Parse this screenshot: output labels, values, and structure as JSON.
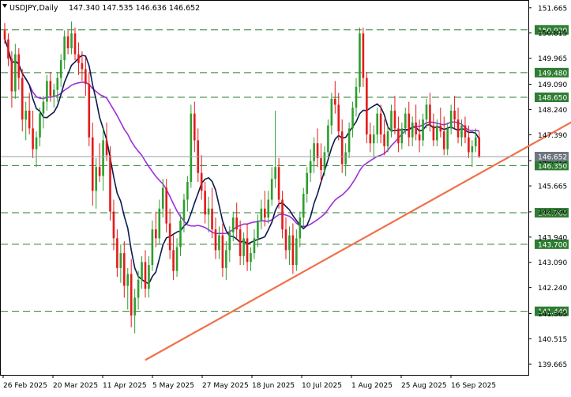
{
  "header": {
    "symbol": "USDJPY,Daily",
    "ohlc": "147.340 147.535 146.636 146.652"
  },
  "chart_data": {
    "type": "candlestick",
    "symbol": "USDJPY",
    "timeframe": "Daily",
    "ylim": [
      139.3,
      151.9
    ],
    "y_ticks": [
      "151.665",
      "150.815",
      "149.965",
      "149.090",
      "148.240",
      "147.390",
      "146.515",
      "145.665",
      "144.790",
      "143.940",
      "143.090",
      "142.240",
      "141.365",
      "140.515",
      "139.665"
    ],
    "x_labels": [
      "26 Feb 2025",
      "20 Mar 2025",
      "11 Apr 2025",
      "5 May 2025",
      "27 May 2025",
      "18 Jun 2025",
      "10 Jul 2025",
      "1 Aug 2025",
      "25 Aug 2025",
      "16 Sep 2025"
    ],
    "levels": [
      150.92,
      149.48,
      148.65,
      146.35,
      144.76,
      143.7,
      141.44
    ],
    "level_labels": [
      "150.920",
      "149.480",
      "148.650",
      "146.350",
      "144.760",
      "143.700",
      "141.440"
    ],
    "current_price": 146.652,
    "current_label": "146.652",
    "trendline": {
      "from": [
        40,
        139.8
      ],
      "to": [
        175,
        148.72
      ]
    },
    "candles": [
      [
        150.9,
        151.15,
        150.45,
        150.6
      ],
      [
        150.6,
        150.8,
        149.7,
        149.95
      ],
      [
        149.95,
        150.2,
        148.3,
        148.85
      ],
      [
        148.85,
        150.45,
        148.6,
        150.1
      ],
      [
        150.1,
        150.3,
        148.9,
        149.3
      ],
      [
        149.3,
        149.6,
        147.5,
        147.9
      ],
      [
        147.9,
        148.5,
        147.2,
        148.2
      ],
      [
        148.2,
        148.8,
        147.4,
        147.6
      ],
      [
        147.6,
        148.2,
        146.6,
        146.9
      ],
      [
        146.9,
        147.5,
        146.3,
        147.3
      ],
      [
        147.3,
        148.3,
        147.0,
        148.1
      ],
      [
        148.1,
        148.7,
        147.6,
        148.5
      ],
      [
        148.5,
        149.4,
        148.2,
        149.2
      ],
      [
        149.2,
        149.5,
        148.5,
        148.7
      ],
      [
        148.7,
        149.1,
        148.3,
        148.9
      ],
      [
        148.9,
        149.5,
        148.5,
        149.3
      ],
      [
        149.3,
        150.1,
        149.0,
        149.9
      ],
      [
        149.9,
        150.9,
        149.6,
        150.7
      ],
      [
        150.7,
        150.9,
        150.1,
        150.3
      ],
      [
        150.3,
        151.2,
        150.1,
        150.8
      ],
      [
        150.8,
        151.0,
        149.9,
        150.1
      ],
      [
        150.1,
        150.5,
        149.4,
        149.8
      ],
      [
        149.8,
        150.2,
        149.2,
        149.6
      ],
      [
        149.6,
        150.0,
        148.7,
        149.1
      ],
      [
        149.1,
        149.5,
        147.0,
        147.3
      ],
      [
        147.3,
        147.8,
        145.0,
        145.5
      ],
      [
        145.5,
        146.6,
        144.9,
        146.3
      ],
      [
        146.3,
        147.1,
        145.8,
        146.0
      ],
      [
        146.0,
        147.6,
        145.5,
        147.2
      ],
      [
        147.2,
        147.8,
        146.5,
        146.7
      ],
      [
        146.7,
        147.0,
        144.5,
        144.8
      ],
      [
        144.8,
        145.2,
        143.5,
        143.9
      ],
      [
        143.9,
        144.2,
        142.6,
        142.9
      ],
      [
        142.9,
        143.7,
        142.4,
        143.4
      ],
      [
        143.4,
        143.8,
        141.9,
        142.3
      ],
      [
        142.3,
        142.9,
        141.5,
        142.7
      ],
      [
        142.7,
        143.2,
        140.9,
        141.3
      ],
      [
        141.3,
        142.2,
        140.7,
        141.9
      ],
      [
        141.9,
        142.8,
        141.5,
        142.5
      ],
      [
        142.5,
        143.3,
        142.2,
        143.1
      ],
      [
        143.1,
        143.5,
        141.9,
        142.2
      ],
      [
        142.2,
        143.3,
        141.9,
        143.0
      ],
      [
        143.0,
        144.5,
        142.8,
        144.2
      ],
      [
        144.2,
        144.8,
        143.6,
        143.9
      ],
      [
        143.9,
        145.2,
        143.7,
        144.9
      ],
      [
        144.9,
        145.9,
        144.6,
        145.6
      ],
      [
        145.6,
        145.9,
        144.1,
        144.4
      ],
      [
        144.4,
        144.9,
        143.2,
        143.5
      ],
      [
        143.5,
        144.0,
        142.5,
        142.8
      ],
      [
        142.8,
        143.9,
        142.6,
        143.6
      ],
      [
        143.6,
        144.7,
        143.3,
        144.5
      ],
      [
        144.5,
        145.4,
        144.1,
        145.2
      ],
      [
        145.2,
        146.0,
        144.8,
        145.8
      ],
      [
        145.8,
        148.4,
        145.6,
        148.1
      ],
      [
        148.1,
        148.5,
        146.8,
        147.2
      ],
      [
        147.2,
        147.6,
        145.8,
        146.1
      ],
      [
        146.1,
        146.7,
        145.2,
        145.5
      ],
      [
        145.5,
        145.8,
        144.4,
        144.7
      ],
      [
        144.7,
        145.3,
        144.1,
        144.9
      ],
      [
        144.9,
        145.6,
        143.9,
        144.2
      ],
      [
        144.2,
        144.6,
        143.2,
        143.5
      ],
      [
        143.5,
        144.3,
        143.2,
        144.0
      ],
      [
        144.0,
        144.4,
        142.6,
        142.9
      ],
      [
        142.9,
        143.8,
        142.5,
        143.5
      ],
      [
        143.5,
        144.3,
        143.1,
        144.1
      ],
      [
        144.1,
        144.8,
        143.8,
        144.6
      ],
      [
        144.6,
        145.1,
        143.9,
        144.2
      ],
      [
        144.2,
        144.5,
        143.0,
        143.3
      ],
      [
        143.3,
        144.1,
        143.0,
        143.9
      ],
      [
        143.9,
        144.4,
        142.8,
        143.1
      ],
      [
        143.1,
        143.6,
        142.8,
        143.4
      ],
      [
        143.4,
        144.2,
        143.2,
        143.9
      ],
      [
        143.9,
        144.7,
        143.6,
        144.5
      ],
      [
        144.5,
        145.2,
        144.2,
        144.9
      ],
      [
        144.9,
        145.5,
        144.3,
        144.6
      ],
      [
        144.6,
        145.5,
        144.4,
        145.2
      ],
      [
        145.2,
        146.3,
        145.0,
        145.9
      ],
      [
        145.9,
        148.2,
        145.6,
        146.3
      ],
      [
        146.3,
        146.6,
        144.9,
        145.2
      ],
      [
        145.2,
        145.5,
        143.9,
        144.2
      ],
      [
        144.2,
        144.6,
        143.2,
        143.5
      ],
      [
        143.5,
        144.3,
        143.0,
        144.0
      ],
      [
        144.0,
        144.4,
        142.7,
        143.0
      ],
      [
        143.0,
        144.2,
        142.8,
        143.9
      ],
      [
        143.9,
        144.8,
        143.6,
        144.6
      ],
      [
        144.6,
        145.6,
        144.3,
        145.4
      ],
      [
        145.4,
        146.3,
        145.1,
        146.1
      ],
      [
        146.1,
        146.9,
        145.8,
        146.5
      ],
      [
        146.5,
        147.3,
        146.1,
        147.1
      ],
      [
        147.1,
        147.6,
        146.3,
        146.6
      ],
      [
        146.6,
        147.1,
        145.8,
        146.2
      ],
      [
        146.2,
        147.0,
        146.0,
        146.8
      ],
      [
        146.8,
        147.9,
        146.6,
        147.7
      ],
      [
        147.7,
        148.8,
        147.4,
        148.6
      ],
      [
        148.6,
        149.2,
        148.1,
        148.4
      ],
      [
        148.4,
        148.8,
        147.2,
        147.5
      ],
      [
        147.5,
        147.9,
        146.1,
        146.4
      ],
      [
        146.4,
        147.1,
        146.0,
        146.8
      ],
      [
        146.8,
        147.8,
        146.6,
        147.6
      ],
      [
        147.6,
        148.5,
        147.3,
        148.3
      ],
      [
        148.3,
        149.3,
        148.0,
        149.0
      ],
      [
        149.0,
        151.0,
        148.8,
        150.8
      ],
      [
        150.8,
        151.0,
        149.0,
        149.3
      ],
      [
        149.3,
        149.5,
        147.1,
        147.4
      ],
      [
        147.4,
        147.8,
        146.8,
        147.1
      ],
      [
        147.1,
        147.7,
        146.6,
        147.4
      ],
      [
        147.4,
        148.3,
        147.1,
        148.1
      ],
      [
        148.1,
        148.4,
        147.1,
        147.4
      ],
      [
        147.4,
        147.9,
        146.7,
        147.0
      ],
      [
        147.0,
        147.7,
        146.8,
        147.5
      ],
      [
        147.5,
        148.4,
        147.3,
        148.2
      ],
      [
        148.2,
        148.7,
        147.4,
        147.6
      ],
      [
        147.6,
        148.0,
        146.8,
        147.1
      ],
      [
        147.1,
        147.8,
        146.9,
        147.6
      ],
      [
        147.6,
        148.3,
        147.4,
        148.1
      ],
      [
        148.1,
        148.5,
        147.0,
        147.3
      ],
      [
        147.3,
        148.0,
        147.0,
        147.8
      ],
      [
        147.8,
        148.4,
        147.2,
        147.4
      ],
      [
        147.4,
        147.9,
        146.8,
        147.2
      ],
      [
        147.2,
        148.1,
        147.0,
        147.9
      ],
      [
        147.9,
        148.6,
        147.6,
        148.4
      ],
      [
        148.4,
        148.8,
        147.5,
        147.7
      ],
      [
        147.7,
        148.1,
        147.0,
        147.2
      ],
      [
        147.2,
        147.9,
        147.0,
        147.7
      ],
      [
        147.7,
        148.3,
        147.3,
        147.5
      ],
      [
        147.5,
        148.0,
        146.7,
        146.9
      ],
      [
        146.9,
        147.8,
        146.7,
        147.6
      ],
      [
        147.6,
        148.4,
        147.4,
        148.2
      ],
      [
        148.2,
        148.7,
        147.6,
        147.9
      ],
      [
        147.9,
        148.3,
        147.1,
        147.3
      ],
      [
        147.3,
        147.9,
        147.0,
        147.7
      ],
      [
        147.7,
        148.0,
        147.1,
        147.3
      ],
      [
        147.3,
        147.7,
        146.6,
        146.8
      ],
      [
        146.8,
        147.2,
        146.3,
        147.0
      ],
      [
        147.0,
        147.6,
        146.8,
        147.3
      ],
      [
        147.3,
        147.5,
        146.6,
        146.65
      ]
    ],
    "ma_fast_color": "#0c1a4e",
    "ma_slow_color": "#9b30d9",
    "up_color": "#2e9e2e",
    "down_color": "#e41a1a",
    "trend_color": "#f0704a",
    "level_color": "#2e7d32",
    "current_tag_color": "#6e7681"
  }
}
